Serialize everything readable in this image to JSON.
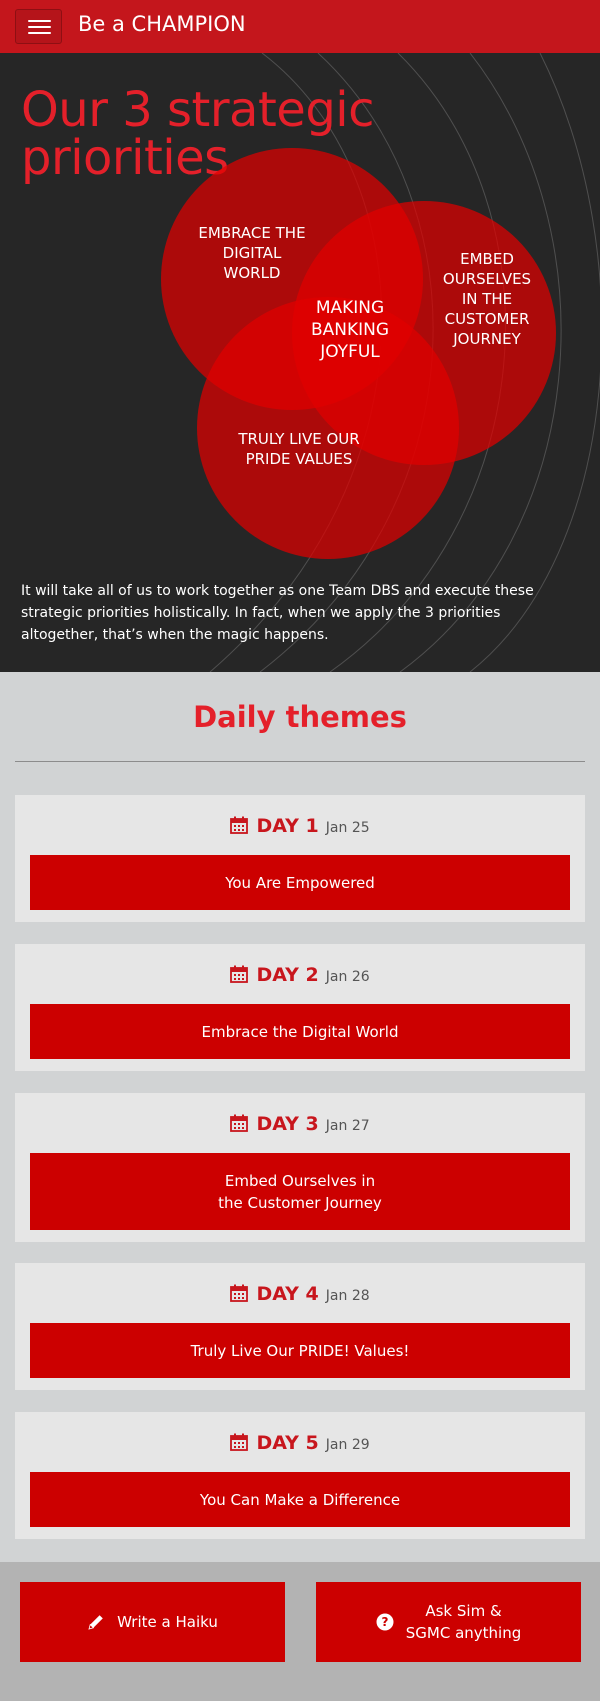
{
  "header": {
    "title": "Be a CHAMPION"
  },
  "hero": {
    "title": "Our 3 strategic priorities",
    "circles": {
      "top_left": [
        "EMBRACE THE",
        "DIGITAL",
        "WORLD"
      ],
      "right": [
        "EMBED",
        "OURSELVES",
        "IN THE",
        "CUSTOMER",
        "JOURNEY"
      ],
      "bottom": [
        "TRULY LIVE OUR",
        "PRIDE VALUES"
      ],
      "center": [
        "MAKING",
        "BANKING",
        "JOYFUL"
      ]
    },
    "description": "It will take all of us to work together as one Team DBS and execute these strategic priorities holistically. In fact, when we apply the 3 priorities altogether, that’s when the magic happens."
  },
  "themes": {
    "heading": "Daily themes",
    "days": [
      {
        "day": "DAY 1",
        "date": "Jan 25",
        "theme": [
          "You Are Empowered"
        ]
      },
      {
        "day": "DAY 2",
        "date": "Jan 26",
        "theme": [
          "Embrace the Digital World"
        ]
      },
      {
        "day": "DAY 3",
        "date": "Jan 27",
        "theme": [
          "Embed Ourselves in",
          "the Customer Journey"
        ]
      },
      {
        "day": "DAY 4",
        "date": "Jan 28",
        "theme": [
          "Truly Live Our PRIDE! Values!"
        ]
      },
      {
        "day": "DAY 5",
        "date": "Jan 29",
        "theme": [
          "You Can Make a Difference"
        ]
      }
    ]
  },
  "footer": {
    "haiku_label": "Write a Haiku",
    "ask_label": [
      "Ask Sim &",
      "SGMC anything"
    ]
  },
  "colors": {
    "brand_red": "#c4161c",
    "button_red": "#cc0000",
    "hero_bg": "#262626",
    "title_red": "#e4202a"
  },
  "icons": {
    "menu": "hamburger-icon",
    "calendar": "calendar-icon",
    "haiku": "pencil-icon",
    "ask": "question-circle-icon"
  }
}
